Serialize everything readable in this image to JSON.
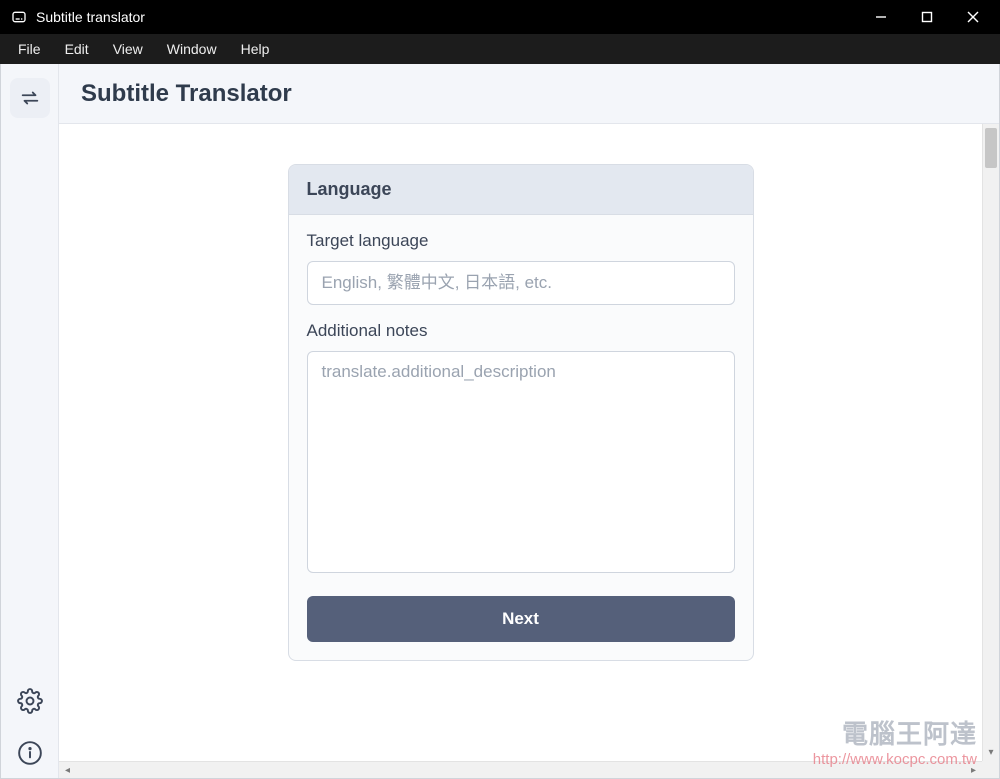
{
  "window": {
    "title": "Subtitle translator"
  },
  "menu": {
    "items": [
      "File",
      "Edit",
      "View",
      "Window",
      "Help"
    ]
  },
  "header": {
    "title": "Subtitle Translator"
  },
  "card": {
    "section_title": "Language",
    "target_language": {
      "label": "Target language",
      "placeholder": "English, 繁體中文, 日本語, etc.",
      "value": ""
    },
    "additional_notes": {
      "label": "Additional notes",
      "placeholder": "translate.additional_description",
      "value": ""
    },
    "next_button_label": "Next"
  },
  "watermark": {
    "text": "電腦王阿達",
    "link": "http://www.kocpc.com.tw"
  }
}
